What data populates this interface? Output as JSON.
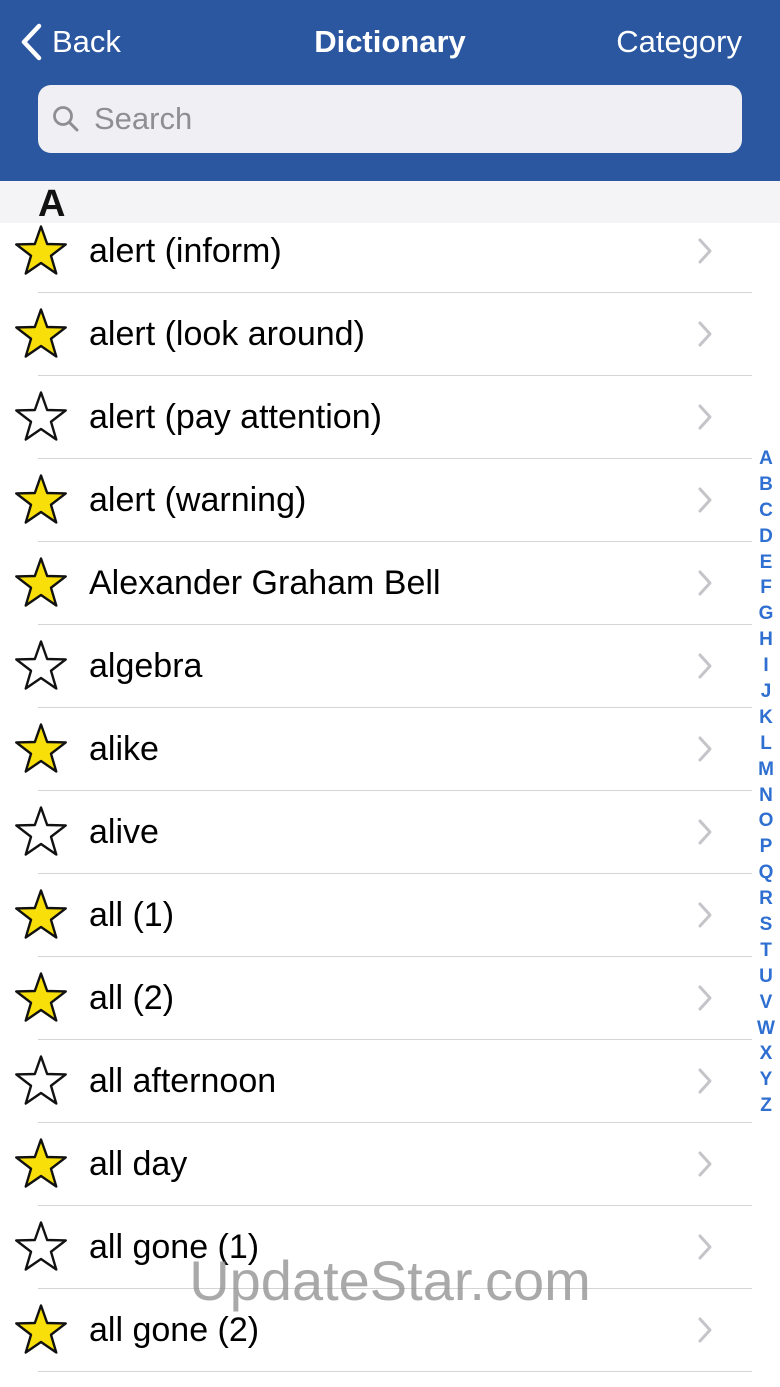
{
  "nav": {
    "back_label": "Back",
    "title": "Dictionary",
    "category_label": "Category",
    "bar_color": "#2a57a0"
  },
  "search": {
    "placeholder": "Search",
    "value": ""
  },
  "section": {
    "letter": "A"
  },
  "entries": [
    {
      "label": "alert (inform)",
      "favorite": true
    },
    {
      "label": "alert (look around)",
      "favorite": true
    },
    {
      "label": "alert (pay attention)",
      "favorite": false
    },
    {
      "label": "alert (warning)",
      "favorite": true
    },
    {
      "label": "Alexander Graham Bell",
      "favorite": true
    },
    {
      "label": "algebra",
      "favorite": false
    },
    {
      "label": "alike",
      "favorite": true
    },
    {
      "label": "alive",
      "favorite": false
    },
    {
      "label": "all (1)",
      "favorite": true
    },
    {
      "label": "all (2)",
      "favorite": true
    },
    {
      "label": "all afternoon",
      "favorite": false
    },
    {
      "label": "all day",
      "favorite": true
    },
    {
      "label": "all gone (1)",
      "favorite": false
    },
    {
      "label": "all gone (2)",
      "favorite": true
    }
  ],
  "index_letters": [
    "A",
    "B",
    "C",
    "D",
    "E",
    "F",
    "G",
    "H",
    "I",
    "J",
    "K",
    "L",
    "M",
    "N",
    "O",
    "P",
    "Q",
    "R",
    "S",
    "T",
    "U",
    "V",
    "W",
    "X",
    "Y",
    "Z"
  ],
  "icons": {
    "back": "chevron-left-icon",
    "search": "magnifier-icon",
    "favorite_on": "star-filled-icon",
    "favorite_off": "star-outline-icon",
    "row_disclosure": "chevron-right-icon"
  },
  "colors": {
    "star_fill": "#f9df0a",
    "index_letter": "#2f6fd1"
  },
  "watermark": "UpdateStar.com"
}
